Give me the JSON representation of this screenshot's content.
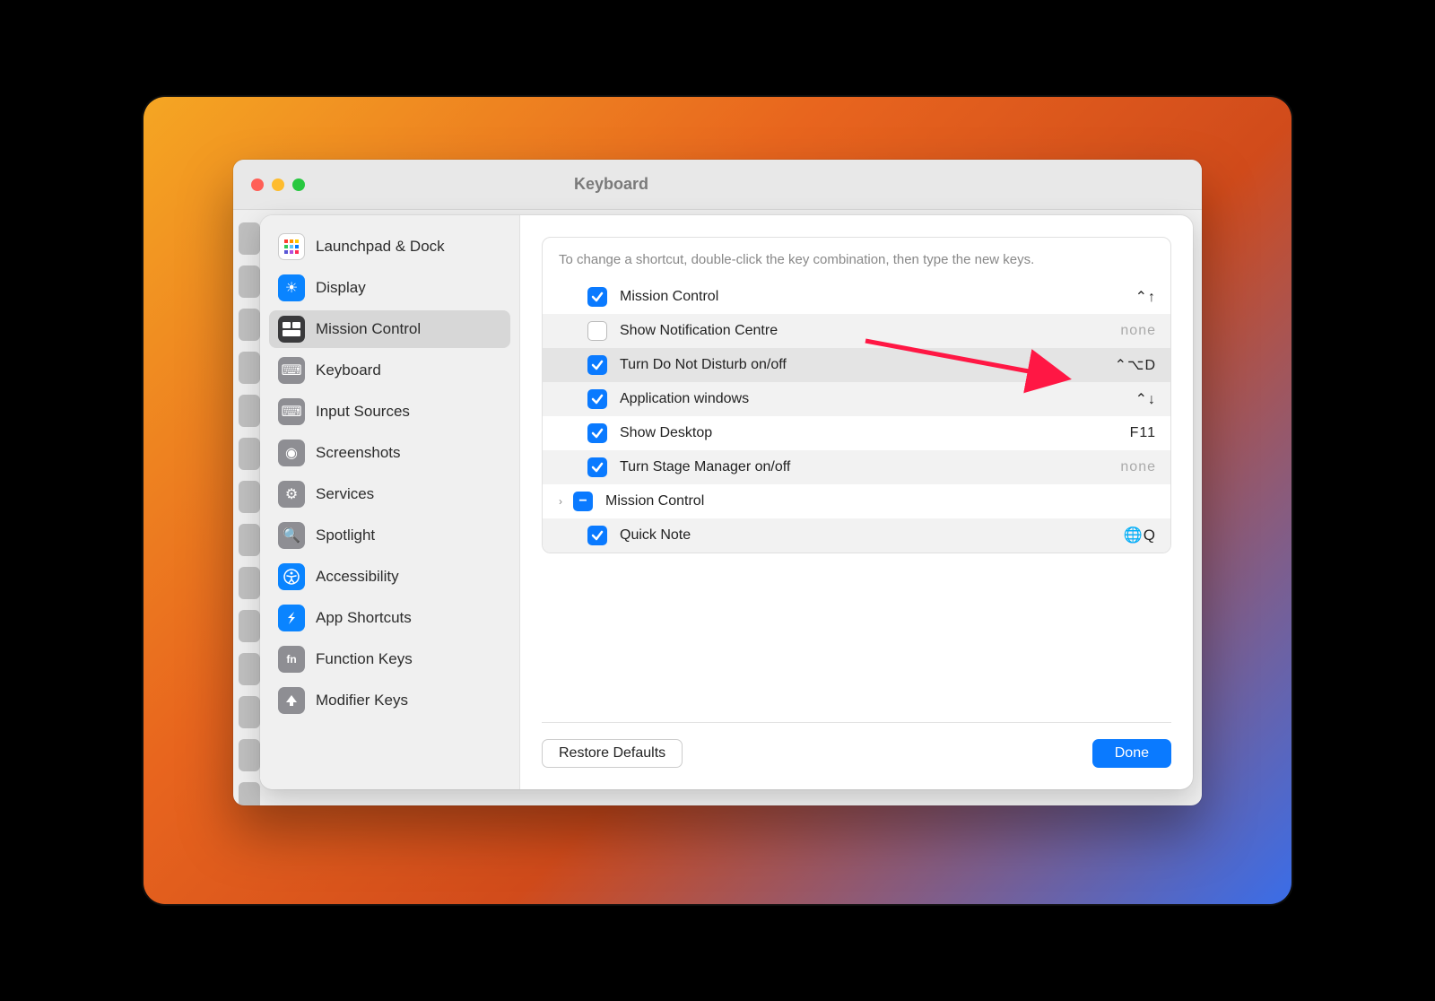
{
  "window": {
    "title": "Keyboard"
  },
  "sidebar": {
    "items": [
      {
        "label": "Launchpad & Dock",
        "icon": "grid"
      },
      {
        "label": "Display",
        "icon": "sun"
      },
      {
        "label": "Mission Control",
        "icon": "mc",
        "selected": true
      },
      {
        "label": "Keyboard",
        "icon": "kb"
      },
      {
        "label": "Input Sources",
        "icon": "kb2"
      },
      {
        "label": "Screenshots",
        "icon": "shot"
      },
      {
        "label": "Services",
        "icon": "gear"
      },
      {
        "label": "Spotlight",
        "icon": "search"
      },
      {
        "label": "Accessibility",
        "icon": "acc"
      },
      {
        "label": "App Shortcuts",
        "icon": "app"
      },
      {
        "label": "Function Keys",
        "icon": "fn"
      },
      {
        "label": "Modifier Keys",
        "icon": "mod"
      }
    ]
  },
  "instructions": "To change a shortcut, double-click the key combination, then type the new keys.",
  "shortcuts": [
    {
      "label": "Mission Control",
      "checked": true,
      "shortcut": "⌃↑"
    },
    {
      "label": "Show Notification Centre",
      "checked": false,
      "shortcut": "none",
      "none": true
    },
    {
      "label": "Turn Do Not Disturb on/off",
      "checked": true,
      "shortcut": "⌃⌥D",
      "selected": true
    },
    {
      "label": "Application windows",
      "checked": true,
      "shortcut": "⌃↓"
    },
    {
      "label": "Show Desktop",
      "checked": true,
      "shortcut": "F11"
    },
    {
      "label": "Turn Stage Manager on/off",
      "checked": true,
      "shortcut": "none",
      "none": true
    },
    {
      "label": "Mission Control",
      "group": true
    },
    {
      "label": "Quick Note",
      "checked": true,
      "shortcut": "🌐Q",
      "globe": true
    }
  ],
  "footer": {
    "restore": "Restore Defaults",
    "done": "Done"
  }
}
